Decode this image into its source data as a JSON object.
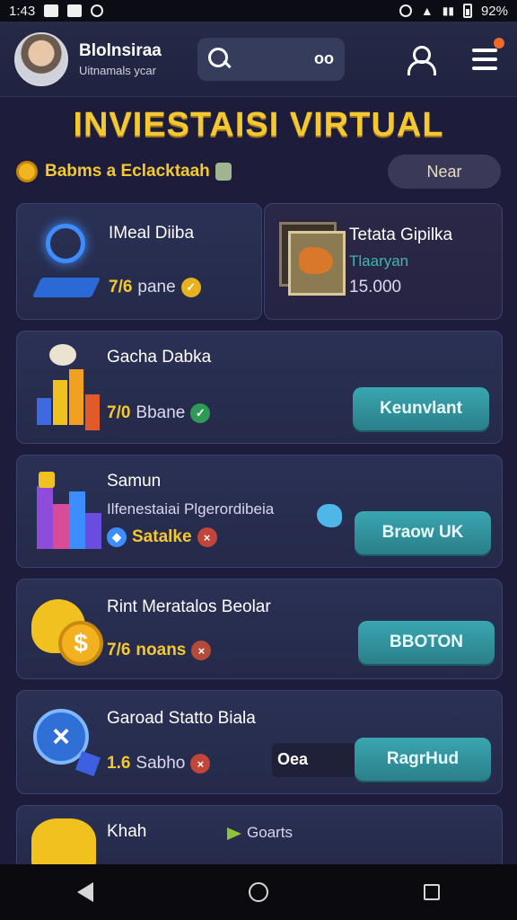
{
  "status_bar": {
    "time": "1:43",
    "battery": "92%"
  },
  "header": {
    "user_name": "Blolnsiraa",
    "user_sub": "Uitnamals ycar",
    "search_hint": "oo"
  },
  "page_title": "INVIESTAISI VIRTUAL",
  "subbar": {
    "label": "Babms a Eclacktaah",
    "filter_label": "Near"
  },
  "cards": {
    "mini_left": {
      "title": "IMeal Diiba",
      "value": "7/6",
      "value_label": "pane"
    },
    "mini_right": {
      "title": "Tetata Gipilka",
      "sub": "Tlaaryan",
      "value": "15.000"
    },
    "item1": {
      "title": "Gacha Dabka",
      "value": "7/0",
      "value_label": "Bbane",
      "button": "Keunvlant"
    },
    "item2": {
      "title": "Samun",
      "sub": "Ilfenestaiai Plgerordibeia",
      "value": "Satalke",
      "button": "Braow UK"
    },
    "item3": {
      "title": "Rint Meratalos Beolar",
      "value": "7/6",
      "value_label": "noans",
      "button": "BBOTON"
    },
    "item4": {
      "title": "Garoad Statto Biala",
      "value": "1.6",
      "value_label": "Sabho",
      "aux": "Oea",
      "button": "RagrHud"
    },
    "item5": {
      "title": "Khah",
      "tag": "Goarts"
    }
  },
  "colors": {
    "accent_gold": "#f3c832",
    "button_teal": "#3aa6b0",
    "background": "#1d1c3a"
  }
}
